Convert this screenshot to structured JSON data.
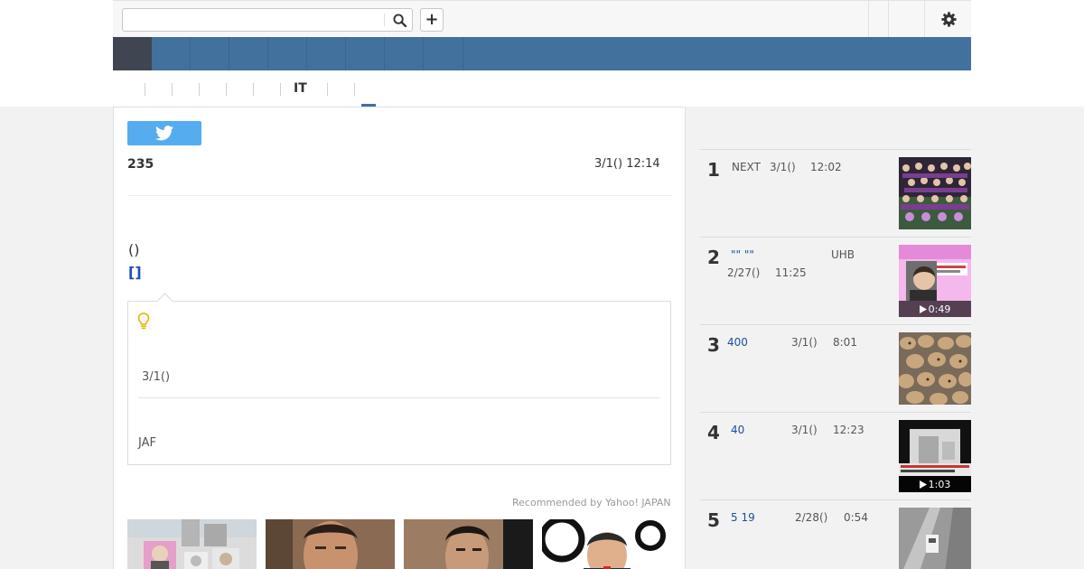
{
  "search": {
    "value": "",
    "placeholder": ""
  },
  "subnav": {
    "it_label": "IT"
  },
  "article": {
    "count": "235",
    "date": "3/1() 12:14",
    "paren_text": "()",
    "link_text": "[]",
    "box_date": "3/1()",
    "box_jaf": "JAF",
    "recommended": "Recommended by Yahoo! JAPAN"
  },
  "ranking": {
    "items": [
      {
        "rank": "1",
        "source": "NEXT",
        "date": "3/1()",
        "time": "12:02",
        "duration": ""
      },
      {
        "rank": "2",
        "title": "\"\"  \"\"",
        "source": "UHB",
        "date": "2/27()",
        "time": "11:25",
        "duration": "0:49"
      },
      {
        "rank": "3",
        "title": "400",
        "date": "3/1()",
        "time": "8:01",
        "duration": ""
      },
      {
        "rank": "4",
        "title": "40",
        "date": "3/1()",
        "time": "12:23",
        "duration": "1:03"
      },
      {
        "rank": "5",
        "title": "5 19",
        "date": "2/28()",
        "time": "0:54",
        "duration": ""
      }
    ]
  },
  "colors": {
    "navbar": "#42719d",
    "nav_home": "#3f4651",
    "twitter": "#55acee",
    "link": "#1c50b8",
    "rank_link": "#1c4f9c"
  },
  "icons": {
    "search": "search-icon",
    "add": "plus-icon",
    "settings": "gear-icon",
    "twitter": "twitter-bird-icon",
    "tip": "lightbulb-icon",
    "play": "play-icon"
  }
}
